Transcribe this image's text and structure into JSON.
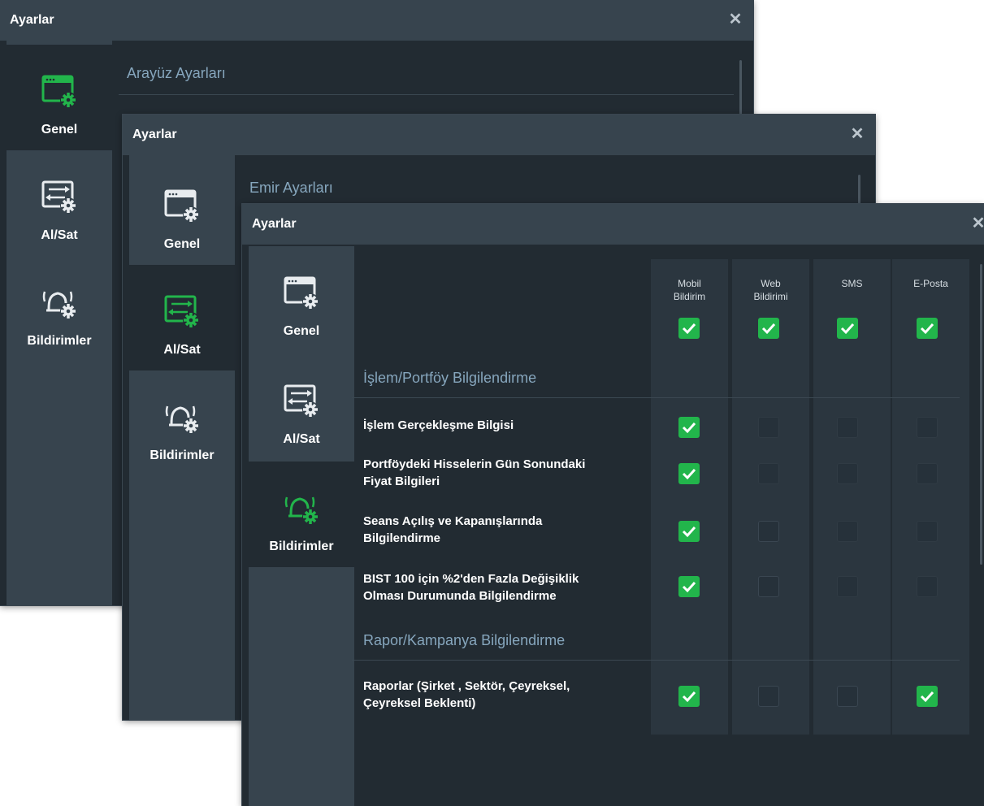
{
  "window1": {
    "title": "Ayarlar",
    "close": "✕",
    "nav": [
      {
        "label": "Genel",
        "icon": "window-gear-icon"
      },
      {
        "label": "Al/Sat",
        "icon": "transfer-gear-icon"
      },
      {
        "label": "Bildirimler",
        "icon": "bell-gear-icon"
      }
    ],
    "section_title": "Arayüz Ayarları"
  },
  "window2": {
    "title": "Ayarlar",
    "close": "✕",
    "nav": [
      {
        "label": "Genel",
        "icon": "window-gear-icon"
      },
      {
        "label": "Al/Sat",
        "icon": "transfer-gear-icon"
      },
      {
        "label": "Bildirimler",
        "icon": "bell-gear-icon"
      }
    ],
    "section_title": "Emir Ayarları"
  },
  "window3": {
    "title": "Ayarlar",
    "close": "✕",
    "nav": [
      {
        "label": "Genel",
        "icon": "window-gear-icon"
      },
      {
        "label": "Al/Sat",
        "icon": "transfer-gear-icon"
      },
      {
        "label": "Bildirimler",
        "icon": "bell-gear-icon"
      }
    ],
    "columns": [
      {
        "line1": "Mobil",
        "line2": "Bildirim",
        "all_checked": true
      },
      {
        "line1": "Web",
        "line2": "Bildirimi",
        "all_checked": true
      },
      {
        "line1": "SMS",
        "line2": "",
        "all_checked": true
      },
      {
        "line1": "E-Posta",
        "line2": "",
        "all_checked": true
      }
    ],
    "sections": [
      {
        "title": "İşlem/Portföy Bilgilendirme",
        "rows": [
          {
            "line1": "İşlem Gerçekleşme Bilgisi",
            "line2": "",
            "checks": [
              true,
              false,
              false,
              false
            ]
          },
          {
            "line1": "Portföydeki Hisselerin Gün Sonundaki",
            "line2": "Fiyat Bilgileri",
            "checks": [
              true,
              false,
              false,
              false
            ]
          },
          {
            "line1": "Seans Açılış ve Kapanışlarında",
            "line2": "Bilgilendirme",
            "checks": [
              true,
              false,
              false,
              false
            ]
          },
          {
            "line1": "BIST 100 için %2'den Fazla Değişiklik",
            "line2": "Olması Durumunda Bilgilendirme",
            "checks": [
              true,
              false,
              false,
              false
            ]
          }
        ]
      },
      {
        "title": "Rapor/Kampanya Bilgilendirme",
        "rows": [
          {
            "line1": "Raporlar (Şirket , Sektör, Çeyreksel,",
            "line2": "Çeyreksel Beklenti)",
            "checks": [
              true,
              false,
              false,
              true
            ]
          }
        ]
      }
    ]
  },
  "colors": {
    "accent": "#22b54b",
    "sidebar": "#37444e",
    "panel": "#222b32",
    "section_title": "#86a6bd"
  }
}
